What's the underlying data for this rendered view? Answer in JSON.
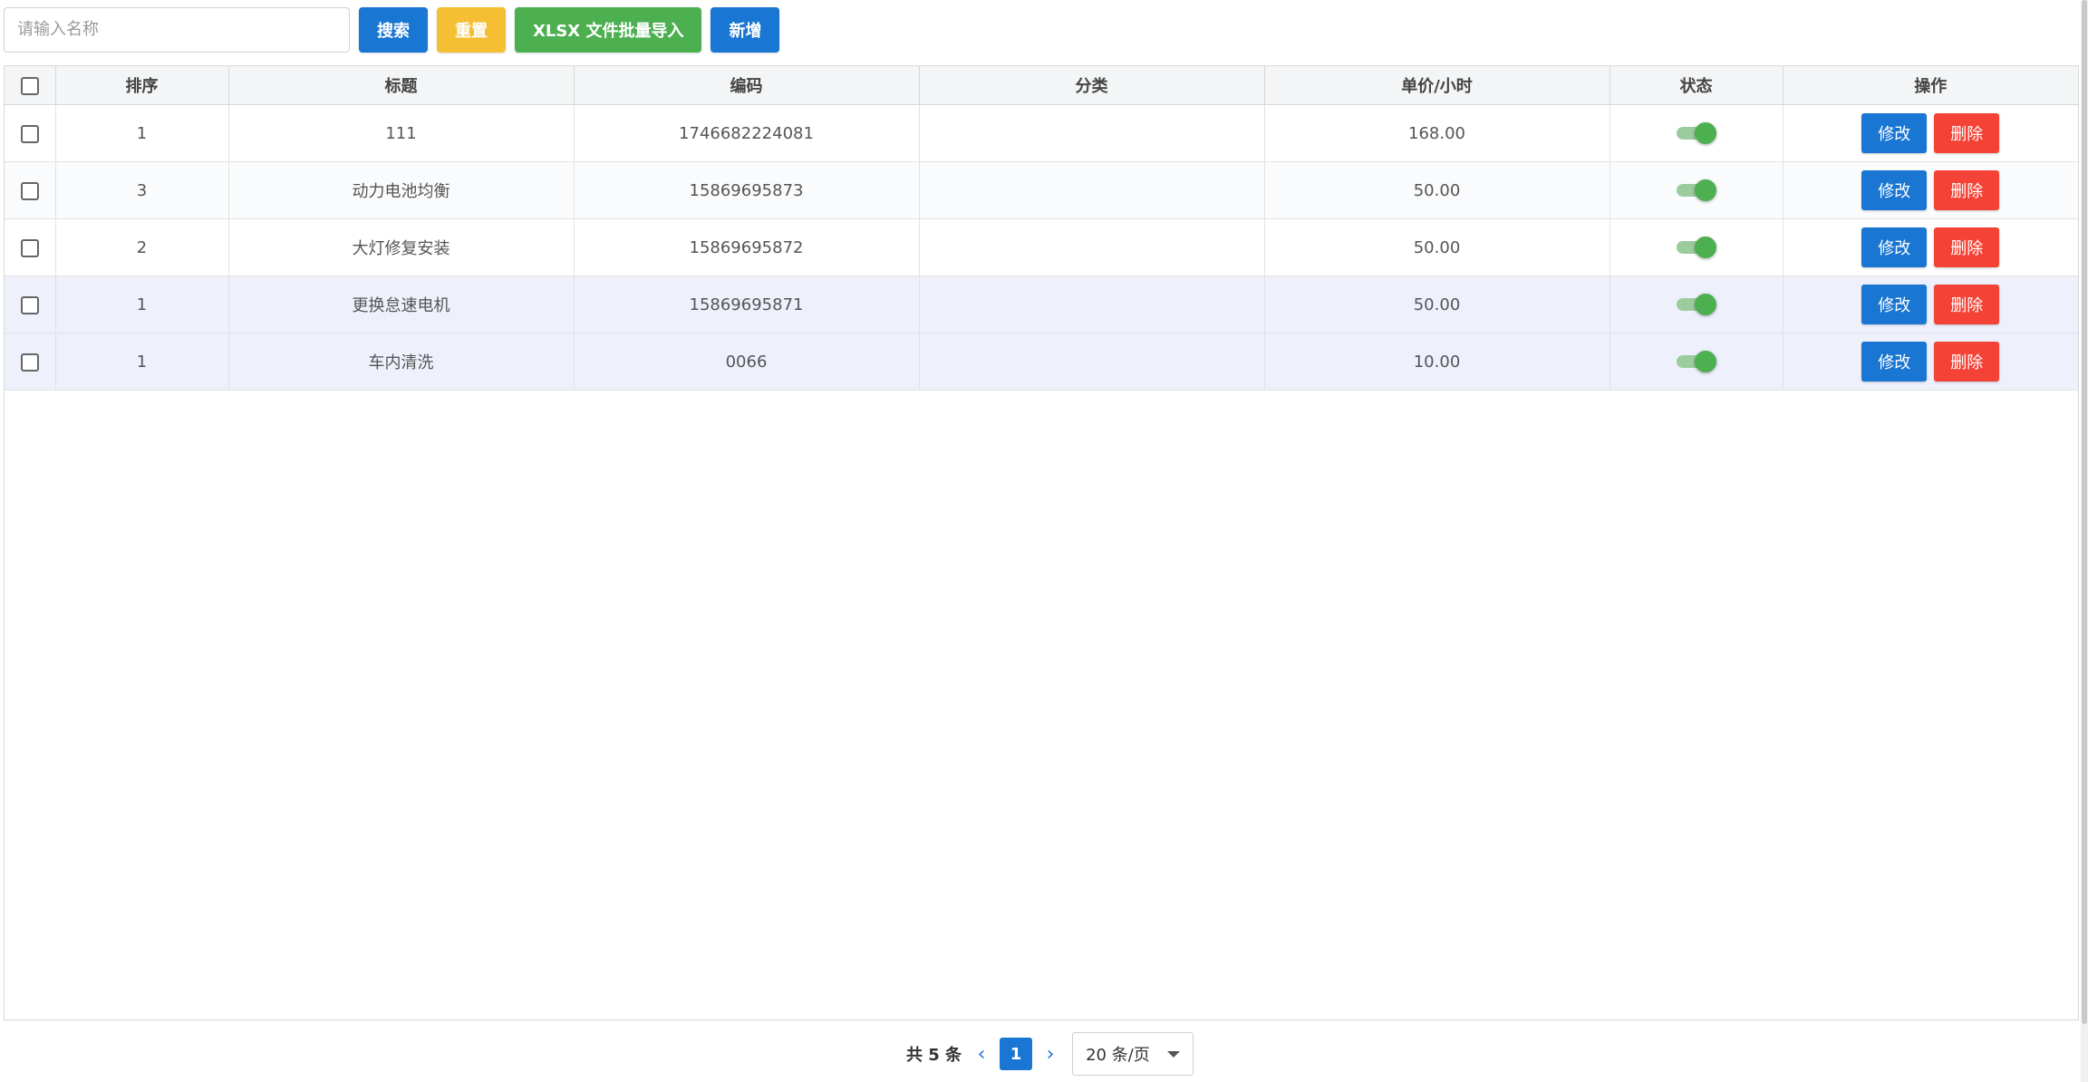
{
  "toolbar": {
    "search_placeholder": "请输入名称",
    "search_label": "搜索",
    "reset_label": "重置",
    "import_label": "XLSX 文件批量导入",
    "add_label": "新增"
  },
  "table": {
    "headers": [
      "排序",
      "标题",
      "编码",
      "分类",
      "单价/小时",
      "状态",
      "操作"
    ],
    "rows": [
      {
        "sort": "1",
        "title": "111",
        "code": "1746682224081",
        "category": "",
        "price": "168.00",
        "status": true
      },
      {
        "sort": "3",
        "title": "动力电池均衡",
        "code": "15869695873",
        "category": "",
        "price": "50.00",
        "status": true
      },
      {
        "sort": "2",
        "title": "大灯修复安装",
        "code": "15869695872",
        "category": "",
        "price": "50.00",
        "status": true
      },
      {
        "sort": "1",
        "title": "更换怠速电机",
        "code": "15869695871",
        "category": "",
        "price": "50.00",
        "status": true
      },
      {
        "sort": "1",
        "title": "车内清洗",
        "code": "0066",
        "category": "",
        "price": "10.00",
        "status": true
      }
    ],
    "edit_label": "修改",
    "delete_label": "删除"
  },
  "pagination": {
    "total_text": "共 5 条",
    "current_page": "1",
    "page_size": "20 条/页"
  },
  "colors": {
    "primary": "#1976d2",
    "warning": "#f4bf33",
    "success": "#4caf50",
    "danger": "#f44336"
  }
}
